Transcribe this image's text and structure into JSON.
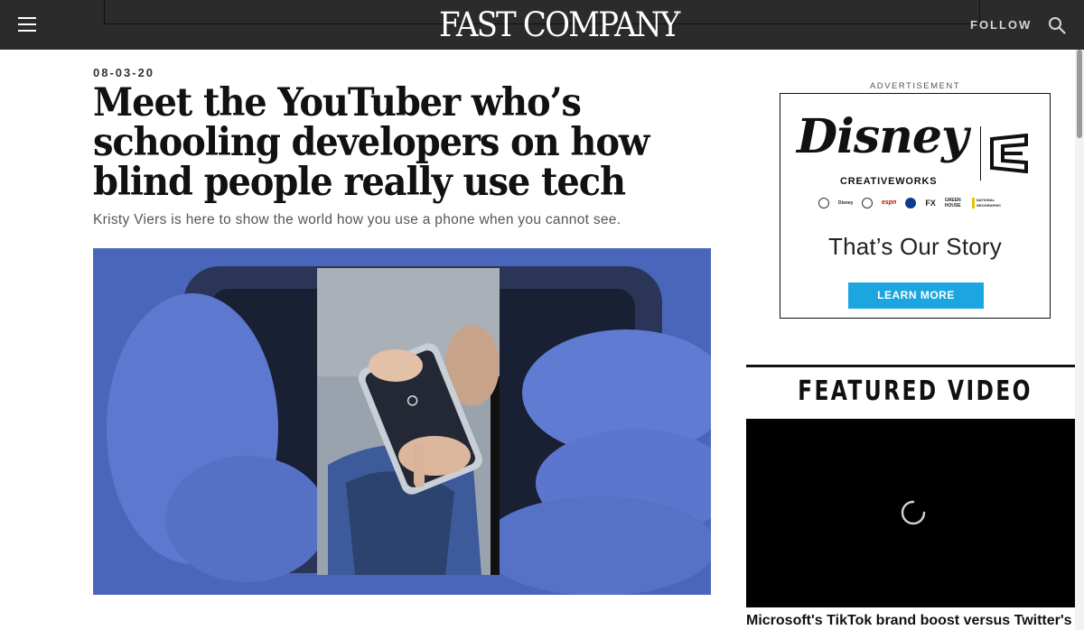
{
  "header": {
    "logo_text": "FAST COMPANY",
    "follow_label": "FOLLOW",
    "menu_icon": "hamburger-menu-icon",
    "search_icon": "search-icon"
  },
  "article": {
    "date": "08-03-20",
    "headline": "Meet the YouTuber who’s schooling developers on how blind people really use tech",
    "subhead": "Kristy Viers is here to show the world how you use a phone when you cannot see.",
    "hero_image": "hero-image-hands-holding-phone"
  },
  "sidebar": {
    "ad_label": "ADVERTISEMENT",
    "ad": {
      "brand": "Disney",
      "sub_brand": "CREATIVEWORKS",
      "network_logos": [
        "abc",
        "Disney Channel",
        "Disney Junior",
        "espn",
        "Nat Geo",
        "FX",
        "GREEN HOUSE",
        "NATIONAL GEOGRAPHIC"
      ],
      "tagline": "That’s Our Story",
      "button_label": "LEARN MORE",
      "button_color": "#1ca6e0"
    },
    "featured_video": {
      "heading": "FEATURED VIDEO",
      "caption": "Microsoft's TikTok brand boost versus Twitter's"
    }
  }
}
